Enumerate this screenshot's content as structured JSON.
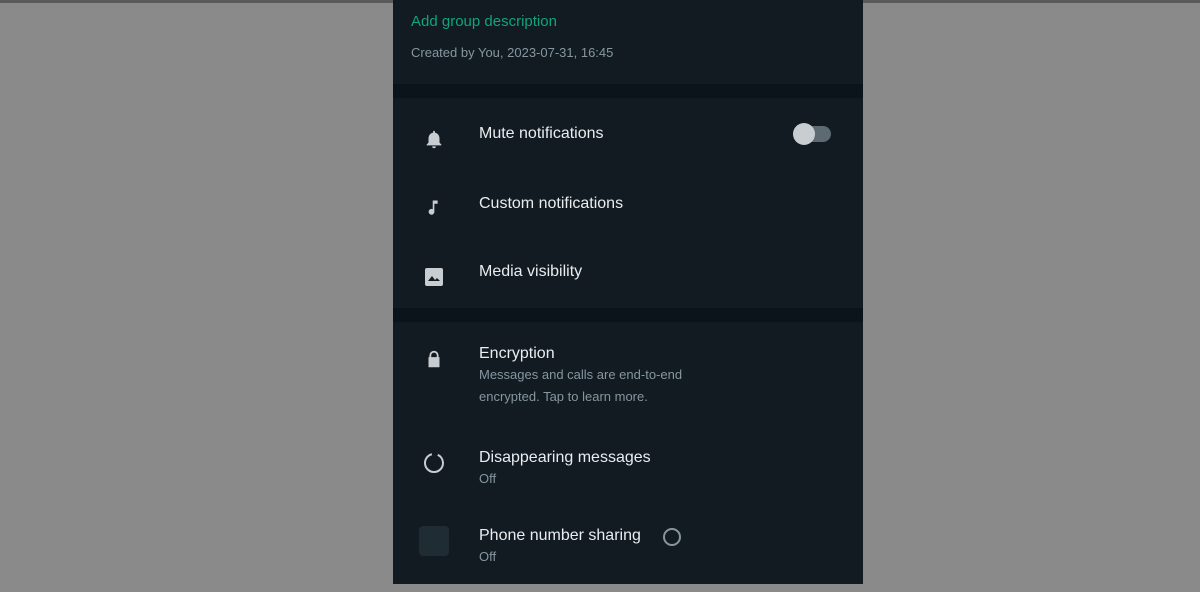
{
  "header": {
    "add_description": "Add group description",
    "created_by": "Created by You, 2023-07-31, 16:45"
  },
  "settings": {
    "mute": {
      "label": "Mute notifications",
      "enabled": false,
      "icon": "bell-icon"
    },
    "custom": {
      "label": "Custom notifications",
      "icon": "music-note-icon"
    },
    "media": {
      "label": "Media visibility",
      "icon": "image-icon"
    },
    "encryption": {
      "label": "Encryption",
      "sub_line1": "Messages and calls are end-to-end",
      "sub_line2": "encrypted. Tap to learn more.",
      "icon": "lock-icon"
    },
    "disappearing": {
      "label": "Disappearing messages",
      "value": "Off",
      "icon": "timer-icon"
    },
    "phone_sharing": {
      "label": "Phone number sharing",
      "value": "Off",
      "icon": "phone-share-icon"
    }
  },
  "colors": {
    "accent": "#0fa37f",
    "panel_bg": "#121b22",
    "divider": "#0b141a",
    "text_primary": "#e9edef",
    "text_secondary": "#8696a0",
    "backdrop": "#8a8a8a"
  }
}
